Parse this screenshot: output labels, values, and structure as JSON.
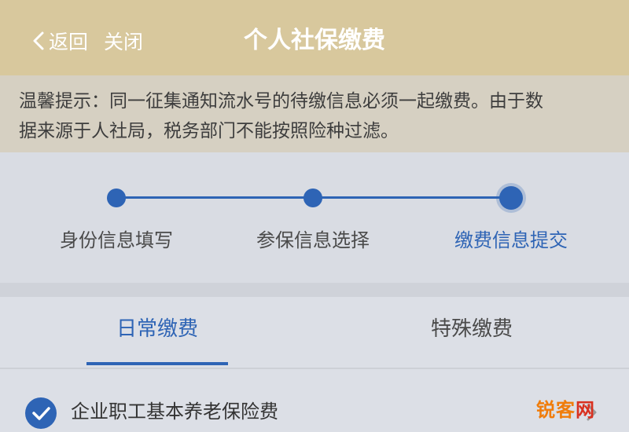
{
  "header": {
    "back_label": "返回",
    "close_label": "关闭",
    "title": "个人社保缴费"
  },
  "notice": {
    "line1": "温馨提示：同一征集通知流水号的待缴信息必须一起缴费。由于数",
    "line2": "据来源于人社局，税务部门不能按照险种过滤。"
  },
  "stepper": {
    "steps": [
      {
        "label": "身份信息填写"
      },
      {
        "label": "参保信息选择"
      },
      {
        "label": "缴费信息提交"
      }
    ],
    "active_step": 3
  },
  "tabs": [
    {
      "label": "日常缴费",
      "active": true
    },
    {
      "label": "特殊缴费",
      "active": false
    }
  ],
  "items": [
    {
      "label": "企业职工基本养老保险费",
      "checked": true
    }
  ],
  "watermark": {
    "text_a": "锐客",
    "text_b": "网"
  },
  "colors": {
    "header_bg": "#d8c89d",
    "accent_blue": "#2e64b5",
    "notice_bg": "#d6d0c2",
    "watermark_orange": "#f07c0a"
  },
  "icons": {
    "back": "chevron-left-icon",
    "check": "check-circle-icon",
    "chevron": "chevron-right-icon"
  }
}
